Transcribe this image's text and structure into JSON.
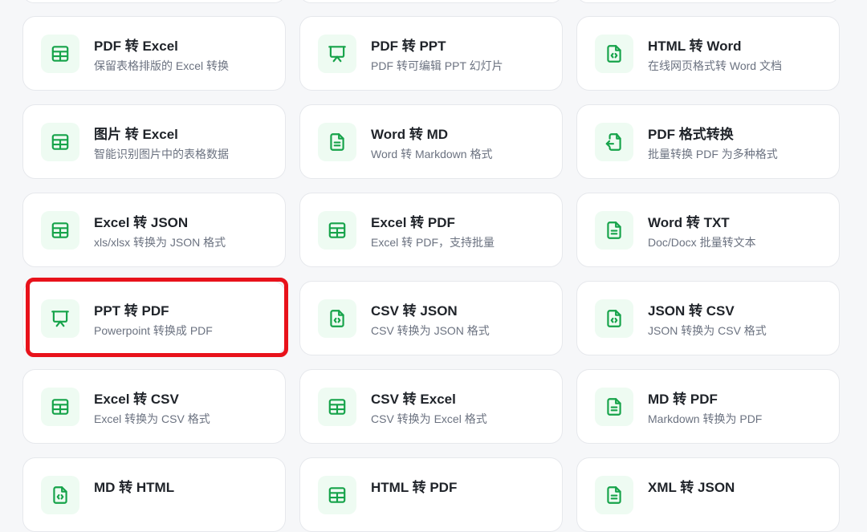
{
  "accent_color": "#16a34a",
  "highlight_color": "#e8121b",
  "tools": [
    {
      "title": "PDF 转 Excel",
      "desc": "保留表格排版的 Excel 转换",
      "icon": "table-icon"
    },
    {
      "title": "PDF 转 PPT",
      "desc": "PDF 转可编辑 PPT 幻灯片",
      "icon": "presentation-icon"
    },
    {
      "title": "HTML 转 Word",
      "desc": "在线网页格式转 Word 文档",
      "icon": "code-file-icon"
    },
    {
      "title": "图片 转 Excel",
      "desc": "智能识别图片中的表格数据",
      "icon": "table-icon"
    },
    {
      "title": "Word 转 MD",
      "desc": "Word 转 Markdown 格式",
      "icon": "document-icon"
    },
    {
      "title": "PDF 格式转换",
      "desc": "批量转换 PDF 为多种格式",
      "icon": "file-convert-icon"
    },
    {
      "title": "Excel 转 JSON",
      "desc": "xls/xlsx 转换为 JSON 格式",
      "icon": "table-icon"
    },
    {
      "title": "Excel 转 PDF",
      "desc": "Excel 转 PDF，支持批量",
      "icon": "table-icon"
    },
    {
      "title": "Word 转 TXT",
      "desc": "Doc/Docx 批量转文本",
      "icon": "document-icon"
    },
    {
      "title": "PPT 转 PDF",
      "desc": "Powerpoint 转换成 PDF",
      "icon": "presentation-icon"
    },
    {
      "title": "CSV 转 JSON",
      "desc": "CSV 转换为 JSON 格式",
      "icon": "code-file-icon"
    },
    {
      "title": "JSON 转 CSV",
      "desc": "JSON 转换为 CSV 格式",
      "icon": "code-file-icon"
    },
    {
      "title": "Excel 转 CSV",
      "desc": "Excel 转换为 CSV 格式",
      "icon": "table-icon"
    },
    {
      "title": "CSV 转 Excel",
      "desc": "CSV 转换为 Excel 格式",
      "icon": "table-icon"
    },
    {
      "title": "MD 转 PDF",
      "desc": "Markdown 转换为 PDF",
      "icon": "document-icon"
    },
    {
      "title": "MD 转 HTML",
      "desc": "",
      "icon": "code-file-icon"
    },
    {
      "title": "HTML 转 PDF",
      "desc": "",
      "icon": "table-icon"
    },
    {
      "title": "XML 转 JSON",
      "desc": "",
      "icon": "document-icon"
    }
  ]
}
